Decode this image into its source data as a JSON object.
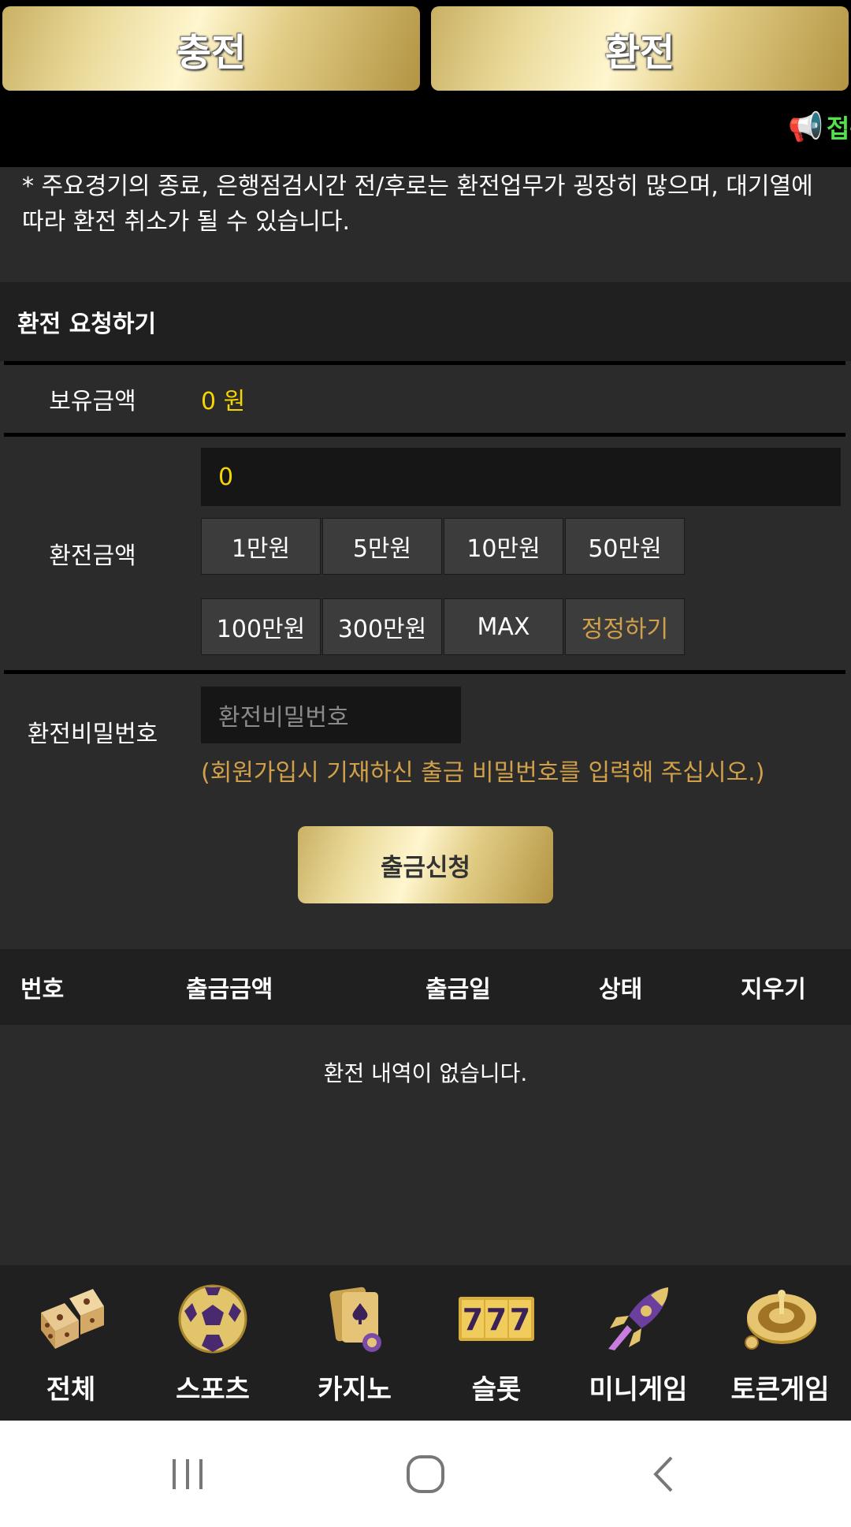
{
  "tabs": {
    "charge": "충전",
    "exchange": "환전"
  },
  "marquee": {
    "icon": "megaphone-icon",
    "text": "접속"
  },
  "notice": "* 주요경기의 종료, 은행점검시간 전/후로는 환전업무가 굉장히 많으며, 대기열에 따라 환전 취소가 될 수 있습니다.",
  "form": {
    "title": "환전 요청하기",
    "hold_label": "보유금액",
    "hold_value": "0 원",
    "amount_label": "환전금액",
    "amount_value": "0",
    "quick_buttons": [
      "1만원",
      "5만원",
      "10만원",
      "50만원",
      "100만원",
      "300만원",
      "MAX",
      "정정하기"
    ],
    "password_label": "환전비밀번호",
    "password_placeholder": "환전비밀번호",
    "password_help": "(회원가입시 기재하신 출금 비밀번호를 입력해 주십시오.)",
    "submit": "출금신청"
  },
  "history": {
    "columns": [
      "번호",
      "출금금액",
      "출금일",
      "상태",
      "지우기"
    ],
    "empty": "환전 내역이 없습니다."
  },
  "bottom_nav": [
    {
      "label": "전체",
      "icon": "dice-icon"
    },
    {
      "label": "스포츠",
      "icon": "soccer-ball-icon"
    },
    {
      "label": "카지노",
      "icon": "playing-cards-icon"
    },
    {
      "label": "슬롯",
      "icon": "slot-777-icon"
    },
    {
      "label": "미니게임",
      "icon": "rocket-icon"
    },
    {
      "label": "토큰게임",
      "icon": "roulette-icon"
    }
  ],
  "colors": {
    "gold": "#e9d998",
    "accent_yellow": "#f6d500",
    "accent_orange": "#d1a04a",
    "marquee_green": "#52e24a"
  }
}
